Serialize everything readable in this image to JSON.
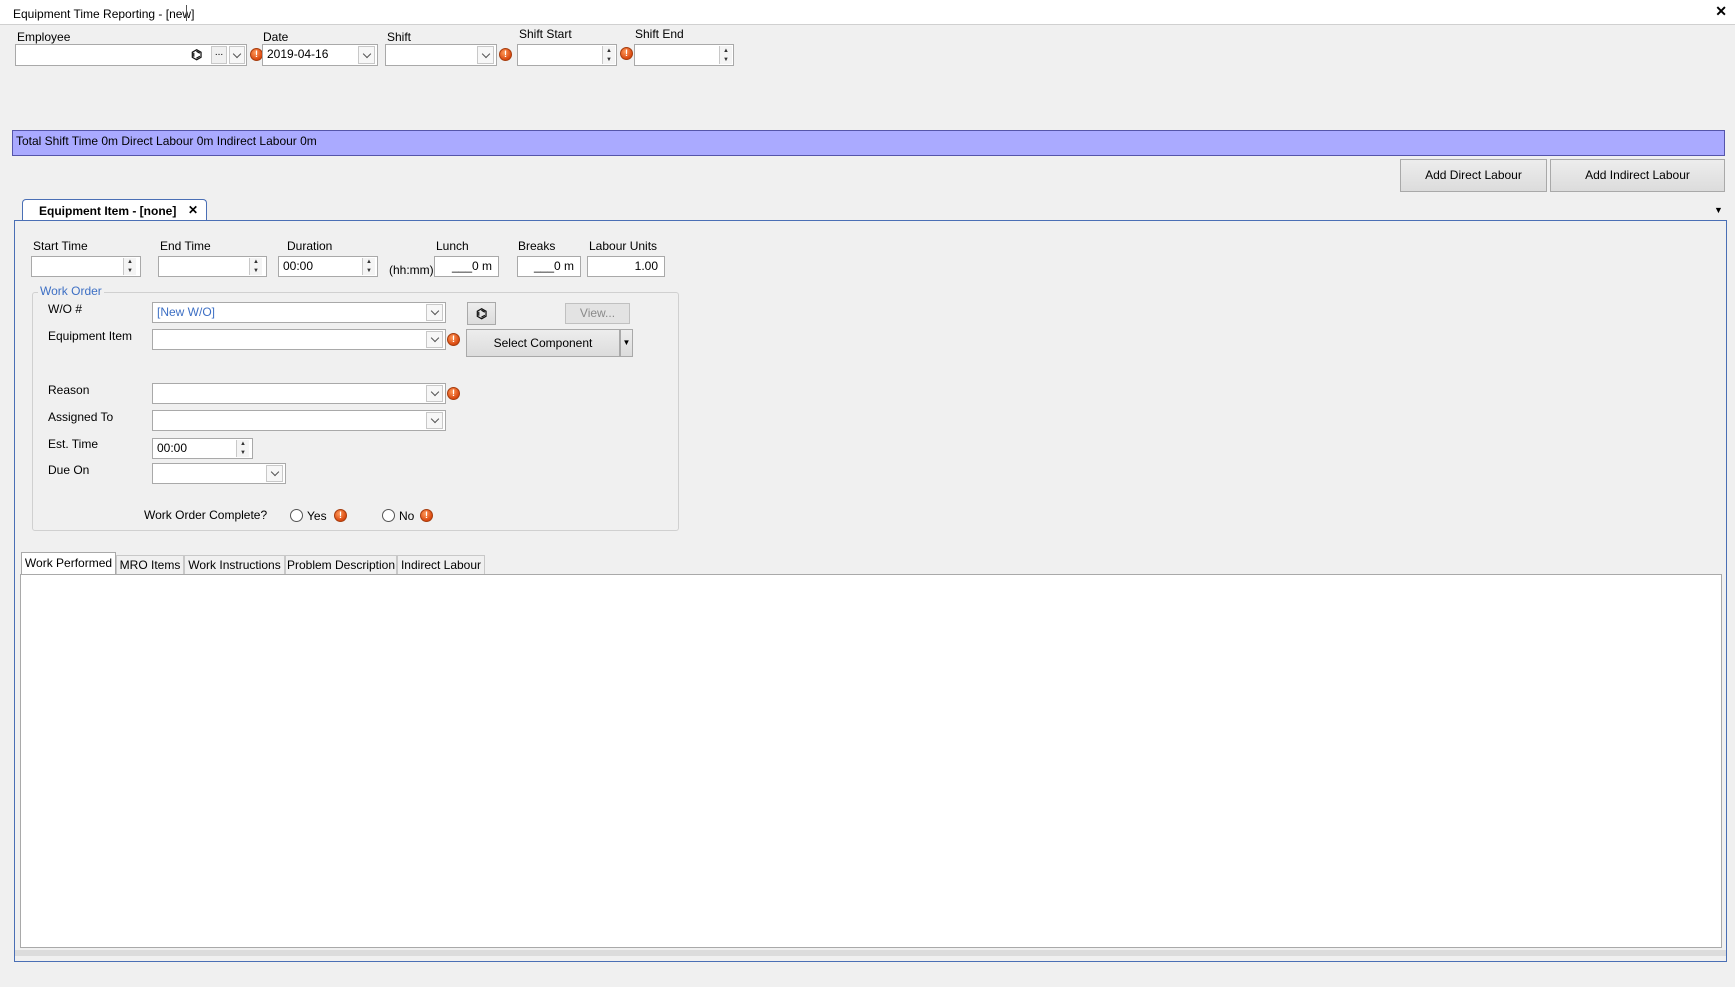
{
  "window": {
    "title": "Equipment Time Reporting - [new]",
    "close_glyph": "✕"
  },
  "header": {
    "employee_label": "Employee",
    "employee_value": "",
    "date_label": "Date",
    "date_value": "2019-04-16",
    "shift_label": "Shift",
    "shift_value": "",
    "shift_start_label": "Shift Start",
    "shift_start_value": "",
    "shift_end_label": "Shift End",
    "shift_end_value": "",
    "ellipsis": "..."
  },
  "summary": {
    "text": "Total Shift Time 0m  Direct Labour 0m  Indirect Labour 0m",
    "color": "#aaaaff"
  },
  "actions": {
    "add_direct": "Add Direct Labour",
    "add_indirect": "Add Indirect Labour"
  },
  "doc_tab": {
    "label": "Equipment Item - [none]",
    "close": "✕"
  },
  "time": {
    "start_label": "Start Time",
    "start_value": "",
    "end_label": "End Time",
    "end_value": "",
    "duration_label": "Duration",
    "duration_value": "00:00",
    "duration_unit": "(hh:mm)",
    "lunch_label": "Lunch",
    "lunch_value": "___0 m",
    "breaks_label": "Breaks",
    "breaks_value": "___0 m",
    "units_label": "Labour Units",
    "units_value": "1.00"
  },
  "work_order": {
    "group_label": "Work Order",
    "wo_label": "W/O #",
    "wo_value": "[New W/O]",
    "view_button": "View...",
    "equipment_label": "Equipment Item",
    "equipment_value": "",
    "select_component": "Select Component",
    "reason_label": "Reason",
    "reason_value": "",
    "assigned_label": "Assigned To",
    "assigned_value": "",
    "est_label": "Est. Time",
    "est_value": "00:00",
    "due_label": "Due On",
    "due_value": "",
    "complete_label": "Work Order Complete?",
    "yes_label": "Yes",
    "no_label": "No"
  },
  "bottom_tabs": [
    "Work Performed",
    "MRO Items",
    "Work Instructions",
    "Problem Description",
    "Indirect Labour"
  ],
  "icons": {
    "warning": "!",
    "binoculars": "binoculars-icon"
  }
}
